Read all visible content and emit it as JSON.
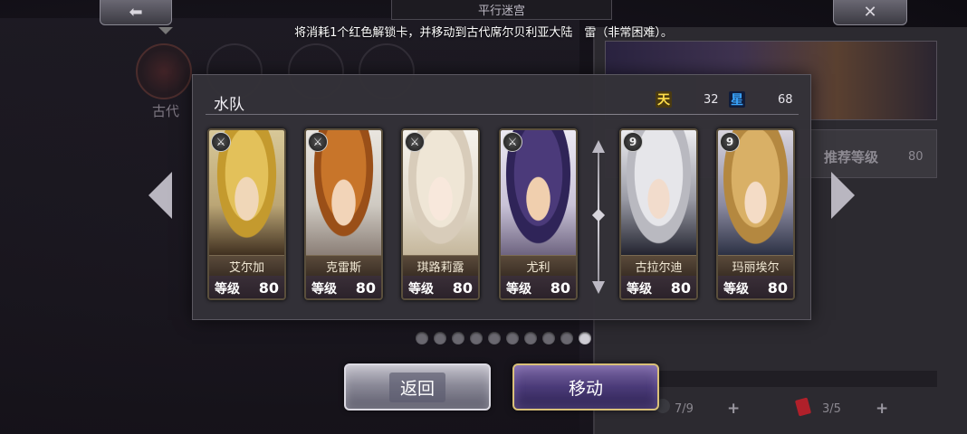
{
  "header": {
    "title": "平行迷宫",
    "back_icon": "arrow-left-icon",
    "close_icon": "close-icon"
  },
  "notice": "将消耗1个红色解锁卡，并移动到古代席尔贝利亚大陆　雷（非常困难）。",
  "background": {
    "region_label": "古代",
    "recommended_label": "推荐等级",
    "recommended_value": "80",
    "stat1": "7/9",
    "stat2": "3/5",
    "plus": "+"
  },
  "dialog": {
    "title": "水队",
    "resources": [
      {
        "icon": "sky-icon",
        "glyph": "天",
        "value": "32"
      },
      {
        "icon": "star-icon",
        "glyph": "星",
        "value": "68"
      }
    ],
    "cards": [
      {
        "name": "艾尔加",
        "level_label": "等级",
        "level": "80",
        "badge": "sword"
      },
      {
        "name": "克雷斯",
        "level_label": "等级",
        "level": "80",
        "badge": "sword"
      },
      {
        "name": "琪路莉露",
        "level_label": "等级",
        "level": "80",
        "badge": "sword"
      },
      {
        "name": "尤利",
        "level_label": "等级",
        "level": "80",
        "badge": "sword"
      },
      {
        "name": "古拉尔迪",
        "level_label": "等级",
        "level": "80",
        "badge": "9"
      },
      {
        "name": "玛丽埃尔",
        "level_label": "等级",
        "level": "80",
        "badge": "9"
      }
    ]
  },
  "pagination": {
    "total": 10,
    "active_index": 9
  },
  "buttons": {
    "back_label": "返回",
    "move_label": "移动"
  },
  "colors": {
    "dialog_bg": "#343238",
    "move_border": "#d9c079"
  }
}
